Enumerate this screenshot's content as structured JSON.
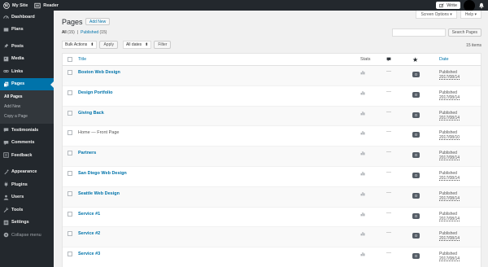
{
  "adminbar": {
    "site_name": "My Site",
    "reader": "Reader",
    "write": "Write",
    "icons": [
      "wordpress-icon",
      "reader-icon",
      "write-icon",
      "bell-icon"
    ]
  },
  "sidebar": {
    "items": [
      {
        "label": "Dashboard",
        "icon": "dashboard-icon"
      },
      {
        "label": "Plans",
        "icon": "plans-icon"
      },
      {
        "label": "Posts",
        "icon": "pin-icon"
      },
      {
        "label": "Media",
        "icon": "media-icon"
      },
      {
        "label": "Links",
        "icon": "links-icon"
      },
      {
        "label": "Pages",
        "icon": "pages-icon"
      },
      {
        "label": "Testimonials",
        "icon": "testimonials-icon"
      },
      {
        "label": "Comments",
        "icon": "comments-icon"
      },
      {
        "label": "Feedback",
        "icon": "feedback-icon"
      },
      {
        "label": "Appearance",
        "icon": "appearance-icon"
      },
      {
        "label": "Plugins",
        "icon": "plugins-icon"
      },
      {
        "label": "Users",
        "icon": "users-icon"
      },
      {
        "label": "Tools",
        "icon": "tools-icon"
      },
      {
        "label": "Settings",
        "icon": "settings-icon"
      },
      {
        "label": "Collapse menu",
        "icon": "collapse-icon"
      }
    ],
    "submenu": [
      "All Pages",
      "Add New",
      "Copy a Page"
    ]
  },
  "main": {
    "title": "Pages",
    "add_new": "Add New",
    "screen_options": "Screen Options ▾",
    "help": "Help ▾",
    "filter_all": "All",
    "filter_all_count": "(15)",
    "separator": "|",
    "filter_published": "Published",
    "filter_published_count": "(15)",
    "search_button": "Search Pages",
    "bulk_actions": "Bulk Actions",
    "apply": "Apply",
    "all_dates": "All dates",
    "filter": "Filter",
    "items_count": "15 items"
  },
  "table": {
    "headers": {
      "title": "Title",
      "stats": "Stats",
      "date": "Date"
    },
    "rows": [
      {
        "title": "Boston Web Design",
        "status": "Published",
        "date": "2017/08/14",
        "comments": "0"
      },
      {
        "title": "Design Portfolio",
        "status": "Published",
        "date": "2017/08/14",
        "comments": "0"
      },
      {
        "title": "Giving Back",
        "status": "Published",
        "date": "2017/08/14",
        "comments": "0"
      },
      {
        "title": "Home — Front Page",
        "status": "Published",
        "date": "2017/08/10",
        "comments": "0"
      },
      {
        "title": "Partners",
        "status": "Published",
        "date": "2017/08/14",
        "comments": "0"
      },
      {
        "title": "San Diego Web Design",
        "status": "Published",
        "date": "2017/08/14",
        "comments": "0"
      },
      {
        "title": "Seattle Web Design",
        "status": "Published",
        "date": "2017/08/14",
        "comments": "0"
      },
      {
        "title": "Service #1",
        "status": "Published",
        "date": "2017/08/14",
        "comments": "0"
      },
      {
        "title": "Service #2",
        "status": "Published",
        "date": "2017/08/14",
        "comments": "0"
      },
      {
        "title": "Service #3",
        "status": "Published",
        "date": "2017/08/14",
        "comments": "0"
      }
    ],
    "stats_placeholder": "—"
  },
  "colors": {
    "admin_bg": "#23282d",
    "accent": "#0073aa",
    "link": "#0073aa"
  }
}
